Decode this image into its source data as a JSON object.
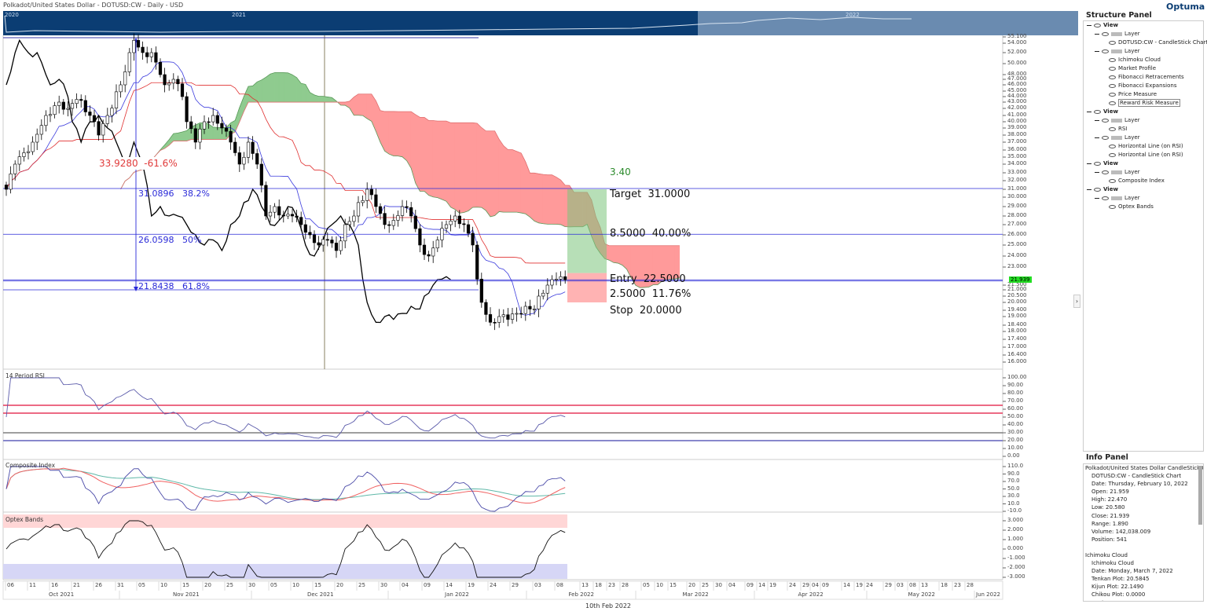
{
  "title": "Polkadot/United States Dollar - DOTUSD:CW - Daily - USD",
  "navigator": {
    "years": [
      "2020",
      "2021",
      "2022"
    ]
  },
  "logo": "Optuma",
  "colors": {
    "navigator_dark": "#0b3d73",
    "navigator_light": "#6a8bb0",
    "cloud_bull": "#8fcb8f",
    "cloud_bear": "#ff9a9a",
    "tenkan": "#3b3bdd",
    "kijun": "#e03030",
    "fib": "#2a2ad8",
    "rsi": "#5a5aaa",
    "last_price": "#22dd22"
  },
  "price_axis": {
    "ticks": [
      "55.100",
      "54.000",
      "52.000",
      "50.000",
      "48.000",
      "47.000",
      "46.000",
      "45.000",
      "44.000",
      "43.000",
      "42.000",
      "41.000",
      "40.000",
      "39.000",
      "38.000",
      "37.000",
      "36.000",
      "35.000",
      "34.000",
      "33.000",
      "32.000",
      "31.000",
      "30.000",
      "29.000",
      "28.000",
      "27.000",
      "26.000",
      "25.000",
      "24.000",
      "23.000",
      "21.500",
      "21.000",
      "20.500",
      "20.000",
      "19.400",
      "19.000",
      "18.400",
      "18.000",
      "17.400",
      "17.000",
      "16.400",
      "16.000"
    ],
    "last_price": "21.939"
  },
  "price_series": {
    "note_type": "candlestick",
    "closes": [
      [
        "2021-10-06",
        31
      ],
      [
        "2021-10-08",
        34
      ],
      [
        "2021-10-12",
        37
      ],
      [
        "2021-10-15",
        41
      ],
      [
        "2021-10-18",
        43
      ],
      [
        "2021-10-20",
        42
      ],
      [
        "2021-10-22",
        43.5
      ],
      [
        "2021-10-25",
        41
      ],
      [
        "2021-10-27",
        38
      ],
      [
        "2021-10-29",
        41
      ],
      [
        "2021-11-01",
        46
      ],
      [
        "2021-11-03",
        52
      ],
      [
        "2021-11-04",
        54.5
      ],
      [
        "2021-11-06",
        52
      ],
      [
        "2021-11-08",
        52
      ],
      [
        "2021-11-10",
        48
      ],
      [
        "2021-11-11",
        46
      ],
      [
        "2021-11-13",
        47
      ],
      [
        "2021-11-15",
        44
      ],
      [
        "2021-11-16",
        40
      ],
      [
        "2021-11-18",
        37
      ],
      [
        "2021-11-20",
        40
      ],
      [
        "2021-11-22",
        41
      ],
      [
        "2021-11-24",
        39
      ],
      [
        "2021-11-26",
        37
      ],
      [
        "2021-11-28",
        34
      ],
      [
        "2021-11-30",
        37
      ],
      [
        "2021-12-02",
        34
      ],
      [
        "2021-12-04",
        28
      ],
      [
        "2021-12-06",
        29
      ],
      [
        "2021-12-08",
        28
      ],
      [
        "2021-12-10",
        28
      ],
      [
        "2021-12-12",
        27
      ],
      [
        "2021-12-14",
        26
      ],
      [
        "2021-12-16",
        25
      ],
      [
        "2021-12-18",
        25.5
      ],
      [
        "2021-12-20",
        24.5
      ],
      [
        "2021-12-22",
        27
      ],
      [
        "2021-12-24",
        28
      ],
      [
        "2021-12-27",
        31
      ],
      [
        "2021-12-29",
        29
      ],
      [
        "2021-12-31",
        27
      ],
      [
        "2022-01-02",
        27.5
      ],
      [
        "2022-01-04",
        29
      ],
      [
        "2022-01-06",
        28
      ],
      [
        "2022-01-08",
        25
      ],
      [
        "2022-01-10",
        24
      ],
      [
        "2022-01-12",
        25.5
      ],
      [
        "2022-01-14",
        27
      ],
      [
        "2022-01-16",
        28
      ],
      [
        "2022-01-18",
        27
      ],
      [
        "2022-01-20",
        25
      ],
      [
        "2022-01-21",
        22
      ],
      [
        "2022-01-22",
        20
      ],
      [
        "2022-01-24",
        18.6
      ],
      [
        "2022-01-26",
        19
      ],
      [
        "2022-01-28",
        18.8
      ],
      [
        "2022-01-30",
        19.2
      ],
      [
        "2022-02-01",
        19.7
      ],
      [
        "2022-02-03",
        19.5
      ],
      [
        "2022-02-04",
        20.5
      ],
      [
        "2022-02-06",
        21.5
      ],
      [
        "2022-02-08",
        22
      ],
      [
        "2022-02-10",
        21.939
      ]
    ]
  },
  "fibonacci": {
    "expansion": {
      "value": "33.9280",
      "pct": "-61.6%"
    },
    "levels": [
      {
        "value": "31.0896",
        "pct": "38.2%",
        "price": 31.0896
      },
      {
        "value": "26.0598",
        "pct": "50%",
        "price": 26.0598
      },
      {
        "value": "21.8438",
        "pct": "61.8%",
        "price": 21.8438
      }
    ]
  },
  "reward_risk": {
    "ratio": "3.40",
    "target_label": "Target",
    "target": "31.0000",
    "reward": "8.5000",
    "reward_pct": "40.00%",
    "entry_label": "Entry",
    "entry": "22.5000",
    "risk": "2.5000",
    "risk_pct": "11.76%",
    "stop_label": "Stop",
    "stop": "20.0000",
    "target_price": 31,
    "entry_price": 22.5,
    "stop_price": 20
  },
  "rsi": {
    "title": "14 Period RSI",
    "ticks": [
      "100.00",
      "90.00",
      "80.00",
      "70.00",
      "60.00",
      "50.00",
      "40.00",
      "30.00",
      "20.00",
      "10.00",
      "0.00"
    ],
    "levels": [
      65,
      55,
      30,
      20
    ]
  },
  "composite": {
    "title": "Composite Index",
    "ticks": [
      "110.0",
      "90.0",
      "70.0",
      "50.0",
      "30.0",
      "10.0",
      "-10.0"
    ]
  },
  "optex": {
    "title": "Optex Bands",
    "ticks": [
      "3.000",
      "2.000",
      "1.000",
      "0.000",
      "-1.000",
      "-2.000",
      "-3.000"
    ]
  },
  "x_axis": {
    "days": [
      "06",
      "11",
      "16",
      "21",
      "26",
      "31",
      "05",
      "10",
      "15",
      "20",
      "25",
      "30",
      "05",
      "10",
      "15",
      "20",
      "25",
      "30",
      "04",
      "09",
      "14",
      "19",
      "24",
      "29",
      "03",
      "08",
      "13",
      "18",
      "23",
      "28",
      "05",
      "10",
      "15",
      "20",
      "25",
      "30",
      "04",
      "09",
      "14",
      "19",
      "24",
      "29",
      "04",
      "09",
      "14",
      "19",
      "24",
      "29",
      "03",
      "08",
      "13",
      "18",
      "23",
      "28"
    ],
    "months": [
      "Oct 2021",
      "Nov 2021",
      "Dec 2021",
      "Jan 2022",
      "Feb 2022",
      "Mar 2022",
      "Apr 2022",
      "May 2022",
      "Jun 2022"
    ],
    "cursor_date": "10th Feb 2022"
  },
  "structure_panel": {
    "title": "Structure Panel",
    "rows": [
      {
        "level": 0,
        "kind": "view",
        "label": "View"
      },
      {
        "level": 1,
        "kind": "layer",
        "label": "Layer"
      },
      {
        "level": 2,
        "kind": "item",
        "label": "DOTUSD:CW - CandleStick Chart"
      },
      {
        "level": 1,
        "kind": "layer",
        "label": "Layer"
      },
      {
        "level": 2,
        "kind": "item",
        "label": "Ichimoku Cloud"
      },
      {
        "level": 2,
        "kind": "item",
        "label": "Market Profile"
      },
      {
        "level": 2,
        "kind": "item",
        "label": "Fibonacci Retracements"
      },
      {
        "level": 2,
        "kind": "item",
        "label": "Fibonacci Expansions"
      },
      {
        "level": 2,
        "kind": "item",
        "label": "Price Measure"
      },
      {
        "level": 2,
        "kind": "item",
        "label": "Reward Risk Measure",
        "selected": true
      },
      {
        "level": 0,
        "kind": "view",
        "label": "View"
      },
      {
        "level": 1,
        "kind": "layer",
        "label": "Layer"
      },
      {
        "level": 2,
        "kind": "item",
        "label": "RSI"
      },
      {
        "level": 1,
        "kind": "layer",
        "label": "Layer"
      },
      {
        "level": 2,
        "kind": "item",
        "label": "Horizontal Line (on RSI)"
      },
      {
        "level": 2,
        "kind": "item",
        "label": "Horizontal Line (on RSI)"
      },
      {
        "level": 0,
        "kind": "view",
        "label": "View"
      },
      {
        "level": 1,
        "kind": "layer",
        "label": "Layer"
      },
      {
        "level": 2,
        "kind": "item",
        "label": "Composite Index"
      },
      {
        "level": 0,
        "kind": "view",
        "label": "View"
      },
      {
        "level": 1,
        "kind": "layer",
        "label": "Layer"
      },
      {
        "level": 2,
        "kind": "item",
        "label": "Optex Bands"
      }
    ]
  },
  "info_panel": {
    "title": "Info Panel",
    "rows": [
      {
        "indent": 0,
        "text": "Polkadot/United States Dollar CandleStick Chart"
      },
      {
        "indent": 1,
        "text": "DOTUSD:CW - CandleStick Chart"
      },
      {
        "indent": 1,
        "text": "Date: Thursday, February 10, 2022"
      },
      {
        "indent": 1,
        "text": "Open: 21.959"
      },
      {
        "indent": 1,
        "text": "High: 22.470"
      },
      {
        "indent": 1,
        "text": "Low: 20.580"
      },
      {
        "indent": 1,
        "text": "Close: 21.939"
      },
      {
        "indent": 1,
        "text": "Range: 1.890"
      },
      {
        "indent": 1,
        "text": "Volume: 142,038.009"
      },
      {
        "indent": 1,
        "text": "Position: 541"
      },
      {
        "indent": 0,
        "text": ""
      },
      {
        "indent": 0,
        "text": "Ichimoku Cloud"
      },
      {
        "indent": 1,
        "text": "Ichimoku Cloud"
      },
      {
        "indent": 1,
        "text": "Date: Monday, March 7, 2022"
      },
      {
        "indent": 1,
        "text": "Tenkan Plot: 20.5845"
      },
      {
        "indent": 1,
        "text": "Kijun Plot: 22.1490"
      },
      {
        "indent": 1,
        "text": "Chikou Plot: 0.0000"
      },
      {
        "indent": 1,
        "text": "Senkou Span A: 21.3668"
      },
      {
        "indent": 1,
        "text": "Senkou Span B: 24.3035"
      }
    ]
  }
}
